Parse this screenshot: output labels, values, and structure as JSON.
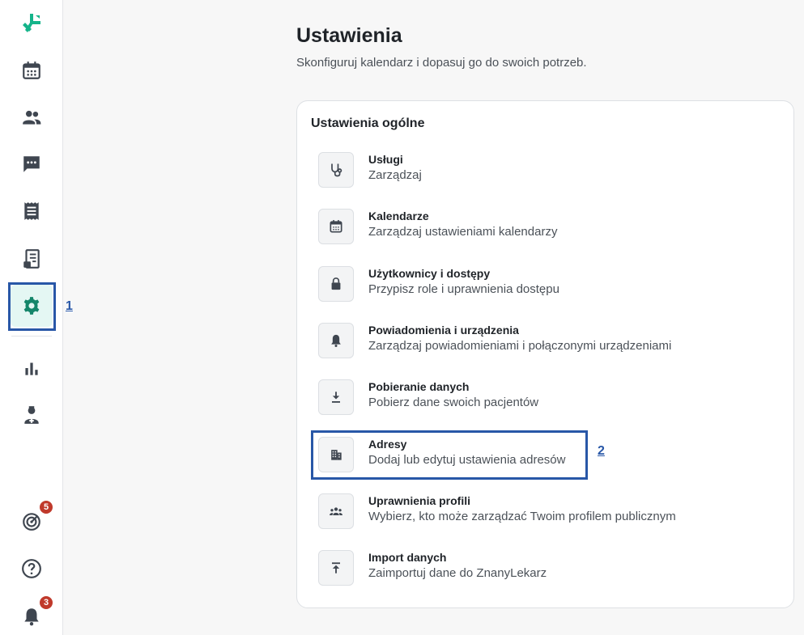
{
  "sidebar": {
    "items": [
      {
        "name": "calendar"
      },
      {
        "name": "patients"
      },
      {
        "name": "messages"
      },
      {
        "name": "invoices"
      },
      {
        "name": "documents"
      },
      {
        "name": "settings",
        "active": true
      },
      {
        "name": "statistics"
      },
      {
        "name": "staff"
      }
    ],
    "bottom": {
      "goals_badge": "5",
      "notifications_badge": "3"
    }
  },
  "annotations": {
    "first": "1",
    "second": "2"
  },
  "page": {
    "title": "Ustawienia",
    "subtitle": "Skonfiguruj kalendarz i dopasuj go do swoich potrzeb."
  },
  "card": {
    "title": "Ustawienia ogólne",
    "rows": [
      {
        "icon": "stethoscope-icon",
        "title": "Usługi",
        "desc": "Zarządzaj"
      },
      {
        "icon": "calendar-icon",
        "title": "Kalendarze",
        "desc": "Zarządzaj ustawieniami kalendarzy"
      },
      {
        "icon": "lock-icon",
        "title": "Użytkownicy i dostępy",
        "desc": "Przypisz role i uprawnienia dostępu"
      },
      {
        "icon": "bell-icon",
        "title": "Powiadomienia i urządzenia",
        "desc": "Zarządzaj powiadomieniami i połączonymi urządzeniami"
      },
      {
        "icon": "download-icon",
        "title": "Pobieranie danych",
        "desc": "Pobierz dane swoich pacjentów"
      },
      {
        "icon": "building-icon",
        "title": "Adresy",
        "desc": "Dodaj lub edytuj ustawienia adresów"
      },
      {
        "icon": "group-icon",
        "title": "Uprawnienia profili",
        "desc": "Wybierz, kto może zarządzać Twoim profilem publicznym"
      },
      {
        "icon": "upload-icon",
        "title": "Import danych",
        "desc": "Zaimportuj dane do ZnanyLekarz"
      }
    ]
  },
  "colors": {
    "brand": "#14b48a",
    "icon": "#3f4650",
    "highlight": "#2857a7",
    "badge": "#c0392b"
  }
}
